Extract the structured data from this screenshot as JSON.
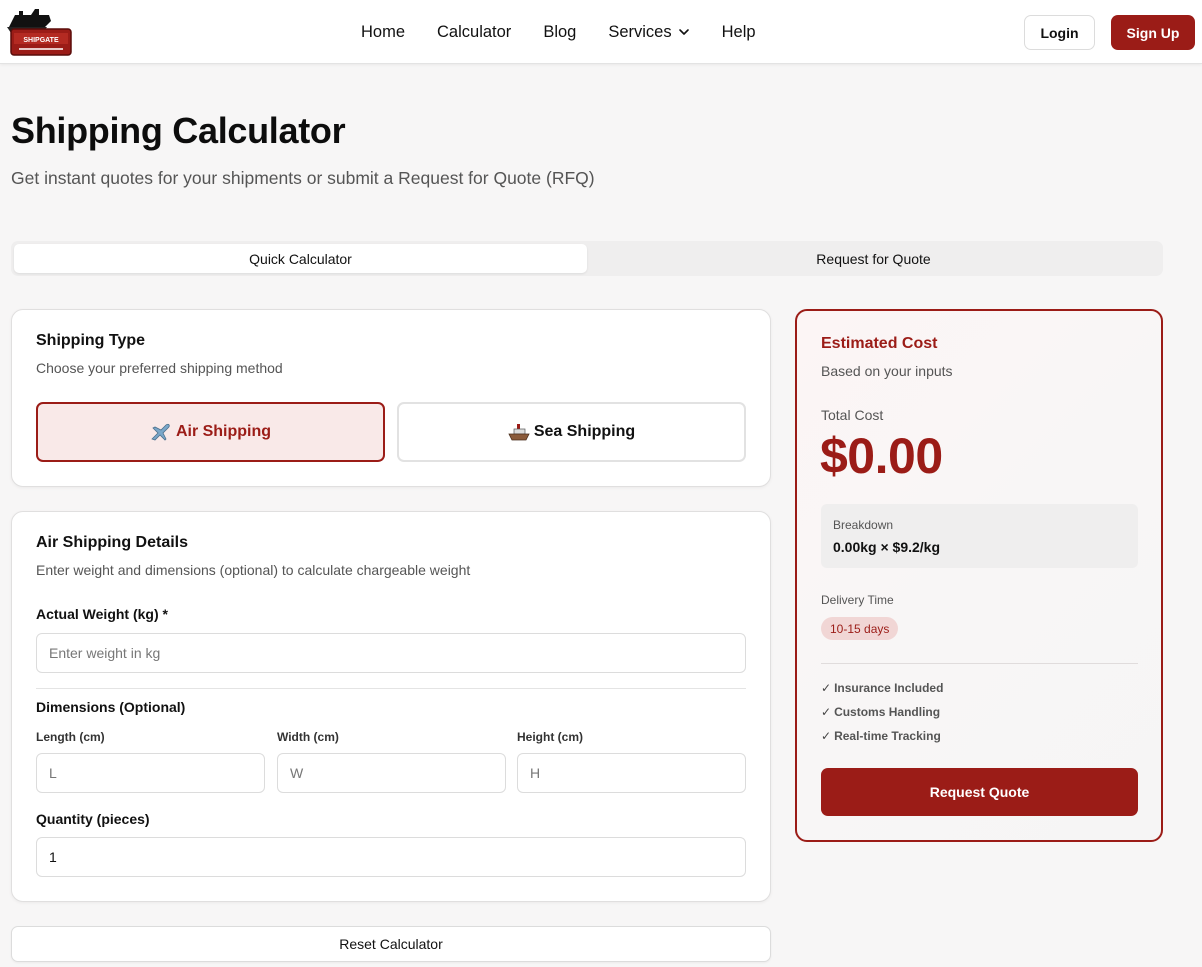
{
  "header": {
    "logo_text": "SHIPGATE",
    "nav": {
      "home": "Home",
      "calculator": "Calculator",
      "blog": "Blog",
      "services": "Services",
      "help": "Help"
    },
    "login": "Login",
    "signup": "Sign Up"
  },
  "page": {
    "title": "Shipping Calculator",
    "subtitle": "Get instant quotes for your shipments or submit a Request for Quote (RFQ)"
  },
  "tabs": {
    "quick": "Quick Calculator",
    "rfq": "Request for Quote",
    "active": "quick"
  },
  "shipping_type": {
    "title": "Shipping Type",
    "desc": "Choose your preferred shipping method",
    "air": "Air Shipping",
    "sea": "Sea Shipping",
    "selected": "air"
  },
  "details": {
    "title": "Air Shipping Details",
    "desc": "Enter weight and dimensions (optional) to calculate chargeable weight",
    "weight_label": "Actual Weight (kg) *",
    "weight_placeholder": "Enter weight in kg",
    "dimensions_label": "Dimensions (Optional)",
    "length_label": "Length (cm)",
    "length_placeholder": "L",
    "width_label": "Width (cm)",
    "width_placeholder": "W",
    "height_label": "Height (cm)",
    "height_placeholder": "H",
    "quantity_label": "Quantity (pieces)",
    "quantity_value": "1"
  },
  "reset": "Reset Calculator",
  "estimate": {
    "title": "Estimated Cost",
    "desc": "Based on your inputs",
    "total_label": "Total Cost",
    "total_value": "$0.00",
    "breakdown_label": "Breakdown",
    "breakdown_value": "0.00kg × $9.2/kg",
    "delivery_label": "Delivery Time",
    "delivery_value": "10-15 days",
    "features": [
      "Insurance Included",
      "Customs Handling",
      "Real-time Tracking"
    ],
    "check": "✓",
    "request_button": "Request Quote"
  },
  "colors": {
    "brand": "#9b1c17",
    "brand_light": "#f9e9e8",
    "page_bg": "#f7f6f6"
  }
}
